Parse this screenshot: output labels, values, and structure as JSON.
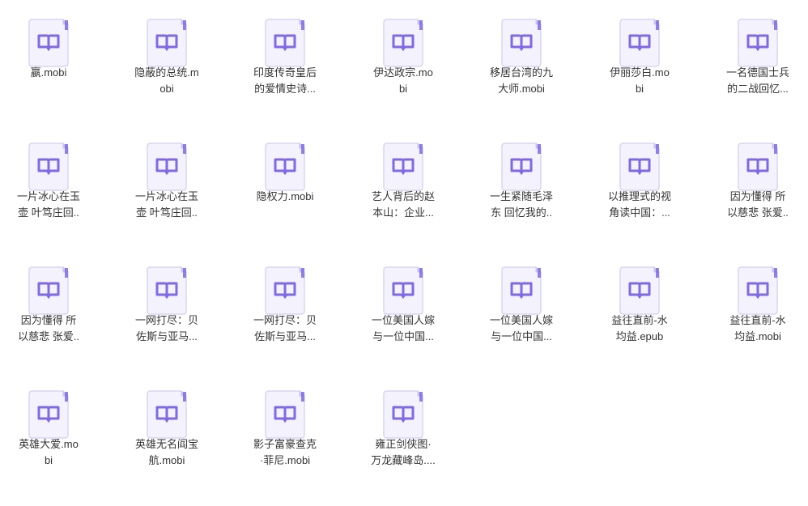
{
  "icon_colors": {
    "paper": "#f4f3fd",
    "border": "#d8d6f4",
    "corner": "#c9c3f0",
    "book": "#8068e6"
  },
  "files": [
    {
      "line1": "嬴.mobi",
      "line2": ""
    },
    {
      "line1": "隐蔽的总统.m",
      "line2": "obi"
    },
    {
      "line1": "印度传奇皇后",
      "line2": "的爱情史诗..."
    },
    {
      "line1": "伊达政宗.mo",
      "line2": "bi"
    },
    {
      "line1": "移居台湾的九",
      "line2": "大师.mobi"
    },
    {
      "line1": "伊丽莎白.mo",
      "line2": "bi"
    },
    {
      "line1": "一名德国士兵",
      "line2": "的二战回忆..."
    },
    {
      "line1": "一片冰心在玉",
      "line2": "壶 叶笃庄回.."
    },
    {
      "line1": "一片冰心在玉",
      "line2": "壶 叶笃庄回.."
    },
    {
      "line1": "隐权力.mobi",
      "line2": ""
    },
    {
      "line1": "艺人背后的赵",
      "line2": "本山：企业..."
    },
    {
      "line1": "一生紧随毛泽",
      "line2": "东 回忆我的.."
    },
    {
      "line1": "以推理式的视",
      "line2": "角读中国：..."
    },
    {
      "line1": "因为懂得 所",
      "line2": "以慈悲 张爱.."
    },
    {
      "line1": "因为懂得 所",
      "line2": "以慈悲 张爱.."
    },
    {
      "line1": "一网打尽：贝",
      "line2": "佐斯与亚马..."
    },
    {
      "line1": "一网打尽：贝",
      "line2": "佐斯与亚马..."
    },
    {
      "line1": "一位美国人嫁",
      "line2": "与一位中国..."
    },
    {
      "line1": "一位美国人嫁",
      "line2": "与一位中国..."
    },
    {
      "line1": "益往直前-水",
      "line2": "均益.epub"
    },
    {
      "line1": "益往直前-水",
      "line2": "均益.mobi"
    },
    {
      "line1": "英雄大爱.mo",
      "line2": "bi"
    },
    {
      "line1": "英雄无名阎宝",
      "line2": "航.mobi"
    },
    {
      "line1": "影子富豪查克",
      "line2": "·菲尼.mobi"
    },
    {
      "line1": "雍正剑侠图·",
      "line2": "万龙藏峰岛...."
    }
  ]
}
